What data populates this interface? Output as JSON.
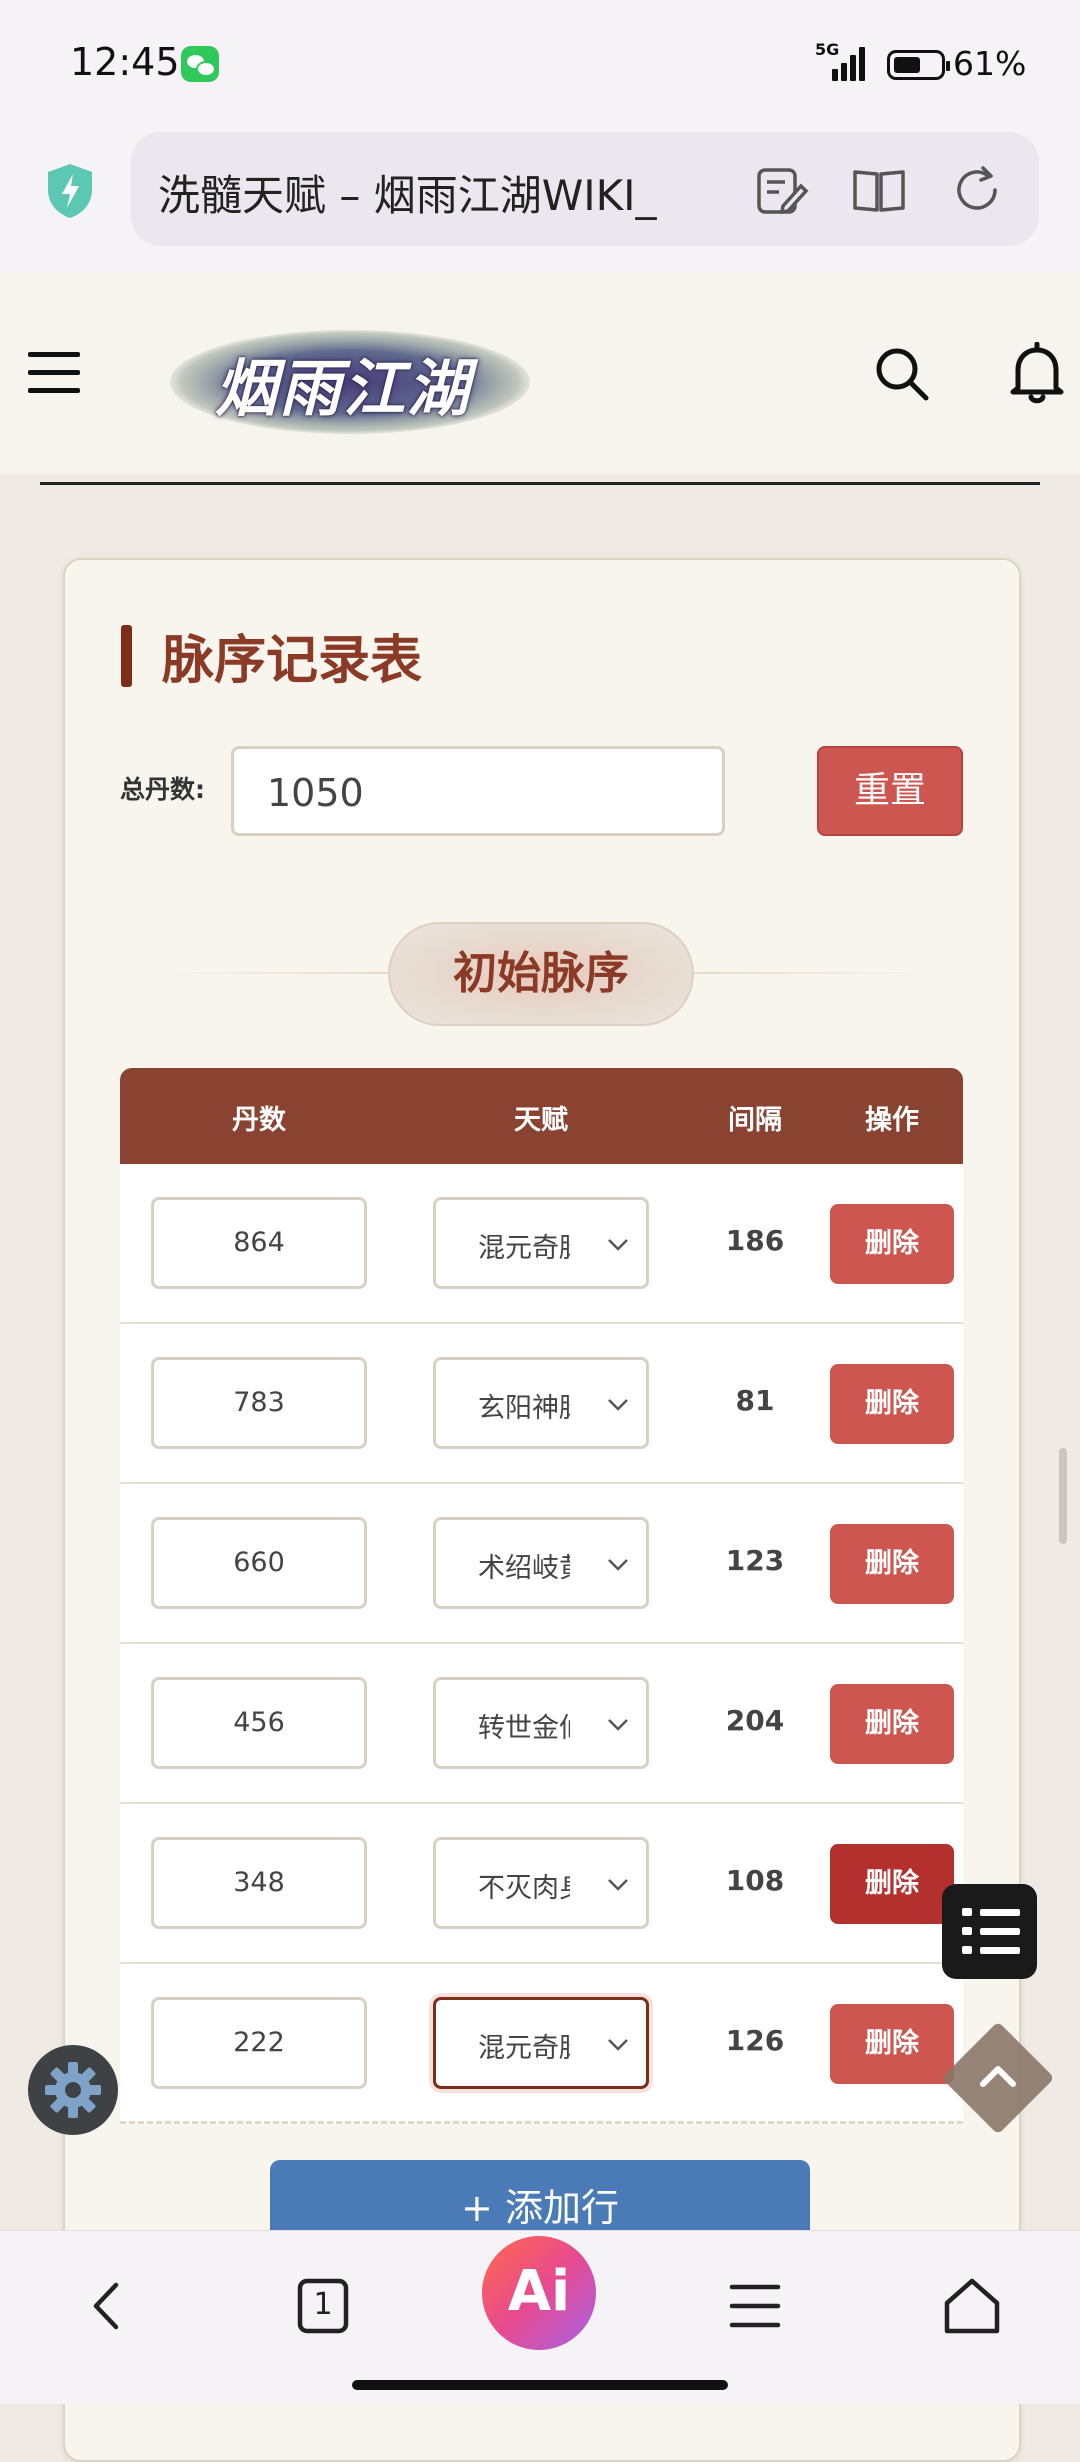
{
  "status": {
    "time": "12:45",
    "network": "5G",
    "battery": "61%"
  },
  "browser": {
    "url_title": "洗髓天赋 – 烟雨江湖WIKI_"
  },
  "site": {
    "logo_text": "烟雨江湖"
  },
  "card": {
    "title": "脉序记录表",
    "total_label": "总丹数:",
    "total_value": "1050",
    "reset_label": "重置",
    "section_title": "初始脉序"
  },
  "table": {
    "headers": {
      "count": "丹数",
      "talent": "天赋",
      "gap": "间隔",
      "action": "操作"
    },
    "rows": [
      {
        "count": "864",
        "talent": "混元奇脉",
        "gap": "186",
        "action": "删除"
      },
      {
        "count": "783",
        "talent": "玄阳神脉",
        "gap": "81",
        "action": "删除"
      },
      {
        "count": "660",
        "talent": "术绍岐黄",
        "gap": "123",
        "action": "删除"
      },
      {
        "count": "456",
        "talent": "转世金仙",
        "gap": "204",
        "action": "删除"
      },
      {
        "count": "348",
        "talent": "不灭肉身",
        "gap": "108",
        "action": "删除"
      },
      {
        "count": "222",
        "talent": "混元奇脉",
        "gap": "126",
        "action": "删除"
      }
    ],
    "add_row_label": "+ 添加行"
  },
  "bottom_nav": {
    "ai_label": "Ai",
    "tab_count": "1"
  },
  "colors": {
    "accent": "#8b3a26",
    "danger": "#cd5650",
    "add_blue": "#4a7bb6"
  }
}
